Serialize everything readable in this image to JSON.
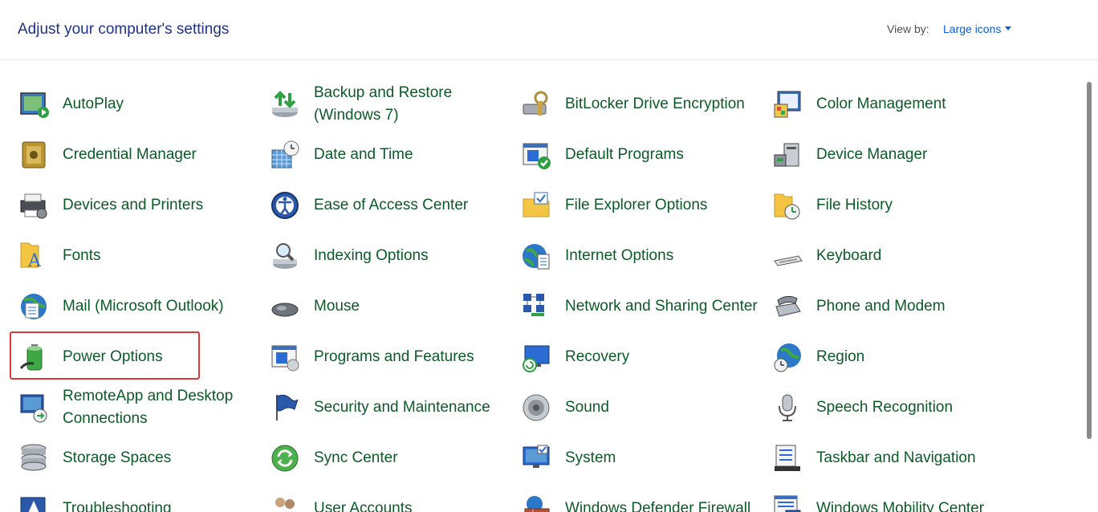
{
  "header": {
    "title": "Adjust your computer's settings",
    "view_by_label": "View by:",
    "view_by_value": "Large icons"
  },
  "items": [
    {
      "label": "AutoPlay",
      "icon": "autoplay-icon"
    },
    {
      "label": "Backup and Restore (Windows 7)",
      "icon": "backup-restore-icon"
    },
    {
      "label": "BitLocker Drive Encryption",
      "icon": "bitlocker-icon"
    },
    {
      "label": "Color Management",
      "icon": "color-management-icon"
    },
    {
      "label": "Credential Manager",
      "icon": "credential-manager-icon"
    },
    {
      "label": "Date and Time",
      "icon": "date-time-icon"
    },
    {
      "label": "Default Programs",
      "icon": "default-programs-icon"
    },
    {
      "label": "Device Manager",
      "icon": "device-manager-icon"
    },
    {
      "label": "Devices and Printers",
      "icon": "devices-printers-icon"
    },
    {
      "label": "Ease of Access Center",
      "icon": "ease-of-access-icon"
    },
    {
      "label": "File Explorer Options",
      "icon": "file-explorer-options-icon"
    },
    {
      "label": "File History",
      "icon": "file-history-icon"
    },
    {
      "label": "Fonts",
      "icon": "fonts-icon"
    },
    {
      "label": "Indexing Options",
      "icon": "indexing-options-icon"
    },
    {
      "label": "Internet Options",
      "icon": "internet-options-icon"
    },
    {
      "label": "Keyboard",
      "icon": "keyboard-icon"
    },
    {
      "label": "Mail (Microsoft Outlook)",
      "icon": "mail-icon"
    },
    {
      "label": "Mouse",
      "icon": "mouse-icon"
    },
    {
      "label": "Network and Sharing Center",
      "icon": "network-sharing-icon"
    },
    {
      "label": "Phone and Modem",
      "icon": "phone-modem-icon"
    },
    {
      "label": "Power Options",
      "icon": "power-options-icon"
    },
    {
      "label": "Programs and Features",
      "icon": "programs-features-icon"
    },
    {
      "label": "Recovery",
      "icon": "recovery-icon"
    },
    {
      "label": "Region",
      "icon": "region-icon"
    },
    {
      "label": "RemoteApp and Desktop Connections",
      "icon": "remoteapp-icon"
    },
    {
      "label": "Security and Maintenance",
      "icon": "security-maintenance-icon"
    },
    {
      "label": "Sound",
      "icon": "sound-icon"
    },
    {
      "label": "Speech Recognition",
      "icon": "speech-recognition-icon"
    },
    {
      "label": "Storage Spaces",
      "icon": "storage-spaces-icon"
    },
    {
      "label": "Sync Center",
      "icon": "sync-center-icon"
    },
    {
      "label": "System",
      "icon": "system-icon"
    },
    {
      "label": "Taskbar and Navigation",
      "icon": "taskbar-navigation-icon"
    },
    {
      "label": "Troubleshooting",
      "icon": "troubleshooting-icon"
    },
    {
      "label": "User Accounts",
      "icon": "user-accounts-icon"
    },
    {
      "label": "Windows Defender Firewall",
      "icon": "firewall-icon"
    },
    {
      "label": "Windows Mobility Center",
      "icon": "mobility-center-icon"
    }
  ],
  "highlighted_item": "Power Options",
  "colors": {
    "title": "#1e3287",
    "link": "#0b5a27",
    "view_by_link": "#0b5ed7",
    "highlight": "#d83a3a"
  }
}
